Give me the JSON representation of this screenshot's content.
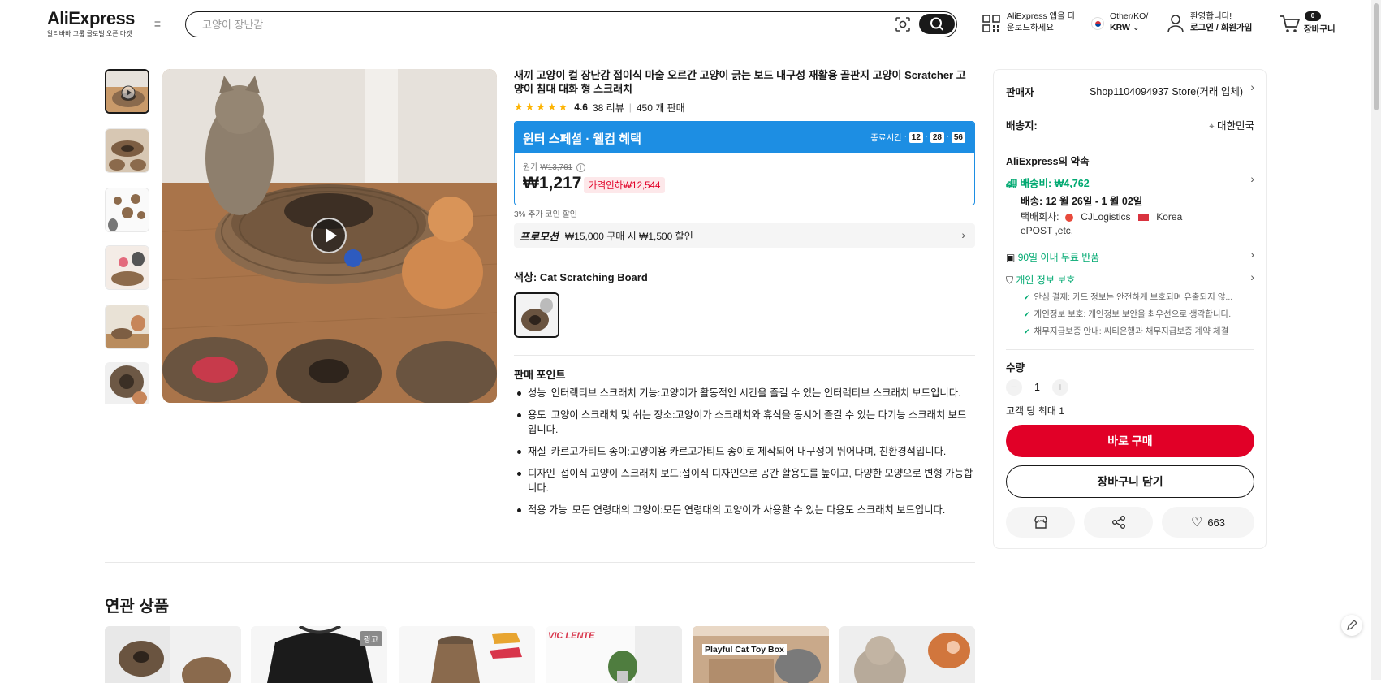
{
  "header": {
    "logo": "AliExpress",
    "logo_sub": "알리바바 그룹 글로벌 오픈 마켓",
    "menu_icon": "hamburger-icon",
    "search_placeholder": "고양이 장난감",
    "app_line1": "AliExpress 앱을 다",
    "app_line2": "운로드하세요",
    "locale_line1": "Other/KO/",
    "currency": "KRW",
    "account_line1": "환영합니다!",
    "account_line2": "로그인 / 회원가입",
    "cart_count": "0",
    "cart_label": "장바구니"
  },
  "gallery": {
    "thumbnail_count": 6,
    "active_index": 0
  },
  "product": {
    "title": "새끼 고양이 컬 장난감 접이식 마술 오르간 고양이 긁는 보드 내구성 재활용 골판지 고양이 Scratcher 고양이 침대 대화 형 스크래치",
    "rating": "4.6",
    "star_rating": 4.6,
    "reviews": "38 리뷰",
    "sold": "450 개 판매",
    "promo_title": "윈터 스페셜 · 웰컴 혜택",
    "timer_label": "종료시간 :",
    "timer_h": "12",
    "timer_m": "28",
    "timer_s": "56",
    "orig_label": "원가",
    "orig_price": "₩13,761",
    "price": "₩1,217",
    "price_drop": "가격인하₩12,544",
    "coin_note": "3% 추가 코인 할인",
    "promotion_label": "프로모션",
    "promotion_text": "₩15,000 구매 시 ₩1,500 할인",
    "color_label": "색상:",
    "color_value": "Cat Scratching Board",
    "selling_points_title": "판매 포인트",
    "selling_points": [
      {
        "k": "성능",
        "v": "인터랙티브 스크래치 기능:고양이가 활동적인 시간을 즐길 수 있는 인터랙티브 스크래치 보드입니다."
      },
      {
        "k": "용도",
        "v": "고양이 스크래치 및 쉬는 장소:고양이가 스크래치와 휴식을 동시에 즐길 수 있는 다기능 스크래치 보드입니다."
      },
      {
        "k": "재질",
        "v": "카르고가티드 종이:고양이용 카르고가티드 종이로 제작되어 내구성이 뛰어나며, 친환경적입니다."
      },
      {
        "k": "디자인",
        "v": "접이식 고양이 스크래치 보드:접이식 디자인으로 공간 활용도를 높이고, 다양한 모양으로 변형 가능합니다."
      },
      {
        "k": "적용 가능",
        "v": "모든 연령대의 고양이:모든 연령대의 고양이가 사용할 수 있는 다용도 스크래치 보드입니다."
      }
    ]
  },
  "panel": {
    "seller_label": "판매자",
    "seller_value": "Shop1104094937 Store(거래 업체)",
    "ship_to_label": "배송지:",
    "ship_to_value": "대한민국",
    "promise_title": "AliExpress의 약속",
    "shipping_fee": "배송비: ₩4,762",
    "delivery": "배송: 12 월 26일 - 1 월 02일",
    "carrier_label": "택배회사:",
    "carrier1": "CJLogistics",
    "carrier2": "Korea",
    "carrier3": "ePOST ,etc.",
    "returns": "90일 이내 무료 반품",
    "privacy": "개인 정보 보호",
    "checks": [
      "안심 결제: 카드 정보는 안전하게 보호되며 유출되지 않...",
      "개인정보 보호: 개인정보 보안을 최우선으로 생각합니다.",
      "채무지급보증 안내: 씨티은행과 채무지급보증 계약 체결"
    ],
    "qty_label": "수량",
    "qty_value": "1",
    "qty_limit": "고객 당 최대 1",
    "buy_now": "바로 구매",
    "add_cart": "장바구니 담기",
    "wishlist_count": "663"
  },
  "related": {
    "title": "연관 상품",
    "ad_badge": "광고",
    "card3_brand": "VIC LENTE",
    "card5_label": "Playful Cat Toy Box"
  },
  "colors": {
    "brand_red": "#e10027",
    "promo_blue": "#1d8ee3",
    "green": "#01a971",
    "star": "#fdb404"
  }
}
